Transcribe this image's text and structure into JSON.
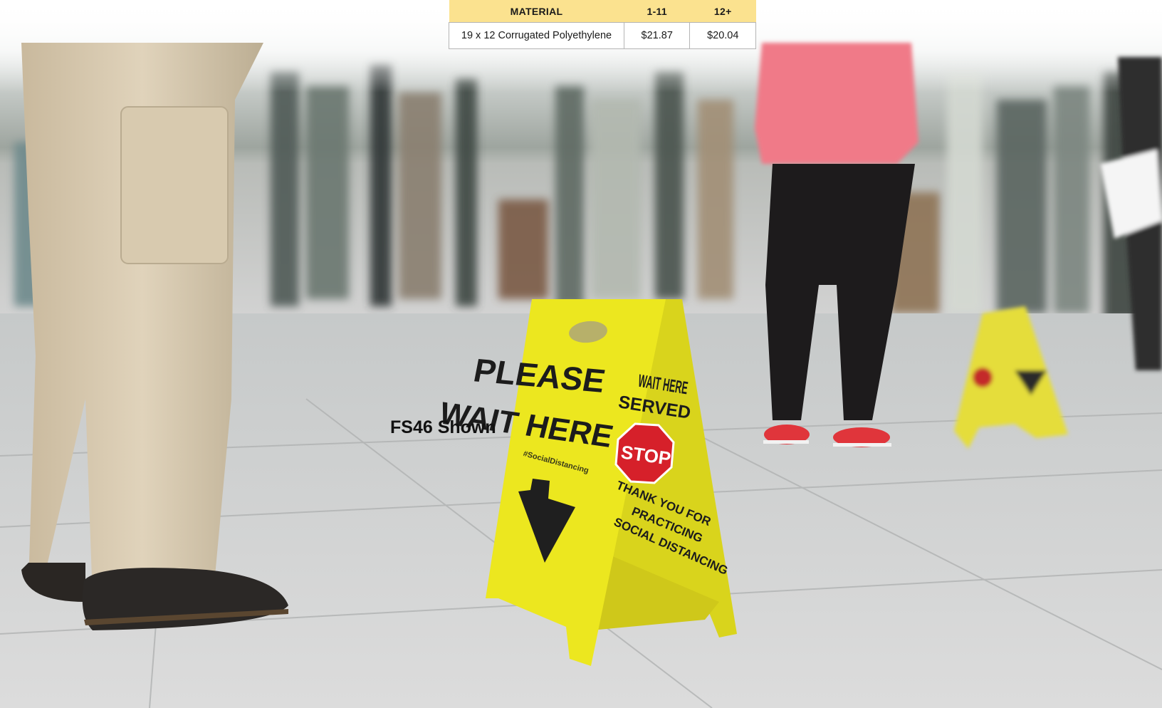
{
  "table": {
    "headers": [
      "MATERIAL",
      "1-11",
      "12+"
    ],
    "rows": [
      [
        "19 x 12 Corrugated Polyethylene",
        "$21.87",
        "$20.04"
      ]
    ]
  },
  "caption": "FS46 Shown",
  "sign": {
    "front_line1": "PLEASE",
    "front_line2": "WAIT HERE",
    "hashtag": "#SocialDistancing",
    "side_line1": "WAIT HERE",
    "side_line2": "SERVED",
    "stop": "STOP",
    "side_line3": "THANK YOU FOR",
    "side_line4": "PRACTICING",
    "side_line5": "SOCIAL DISTANCING"
  },
  "colors": {
    "table_header": "#fbe28f",
    "sign_yellow": "#e9e41f",
    "stop_red": "#d6202a",
    "floor": "#d5d5d5"
  }
}
